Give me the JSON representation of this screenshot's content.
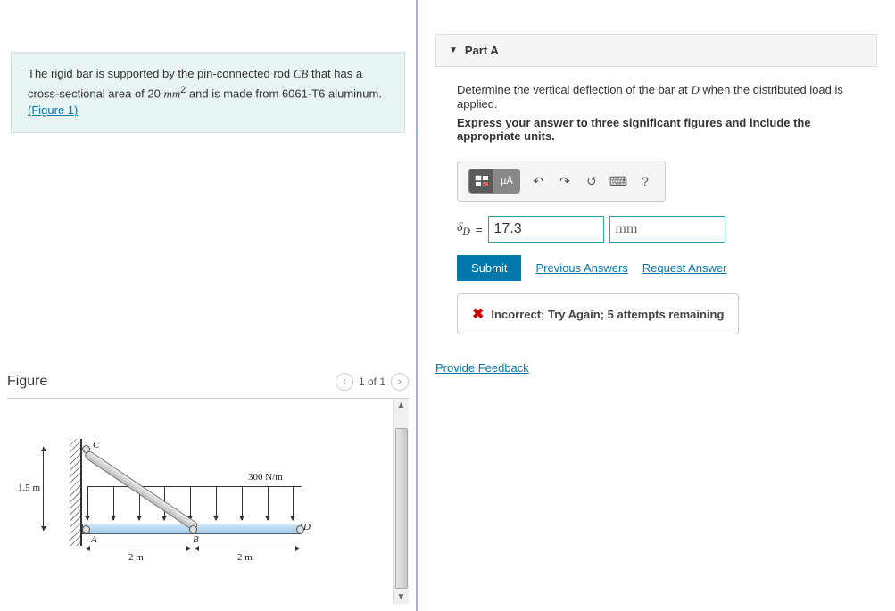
{
  "problem": {
    "text_pre": "The rigid bar is supported by the pin-connected rod ",
    "rod_label": "CB",
    "text_mid1": " that has a cross-sectional area of 20 ",
    "area_unit": "mm",
    "text_mid2": " and is made from 6061-T6 aluminum.",
    "figure_link": "(Figure 1)"
  },
  "figure": {
    "title": "Figure",
    "pager": "1 of 1",
    "labels": {
      "C": "C",
      "A": "A",
      "B": "B",
      "D": "D",
      "h": "1.5 m",
      "w1": "2 m",
      "w2": "2 m",
      "load": "300 N/m"
    }
  },
  "part": {
    "title": "Part A",
    "instr1_pre": "Determine the vertical deflection of the bar at ",
    "instr1_var": "D",
    "instr1_post": " when the distributed load is applied.",
    "instr2": "Express your answer to three significant figures and include the appropriate units.",
    "toolbar": {
      "units_btn": "µÅ"
    },
    "answer": {
      "label_html": "δ",
      "label_sub": "D",
      "equals": " = ",
      "value": "17.3",
      "unit": "mm"
    },
    "actions": {
      "submit": "Submit",
      "prev": "Previous Answers",
      "req": "Request Answer"
    },
    "feedback": "Incorrect; Try Again; 5 attempts remaining"
  },
  "provide_feedback": "Provide Feedback"
}
